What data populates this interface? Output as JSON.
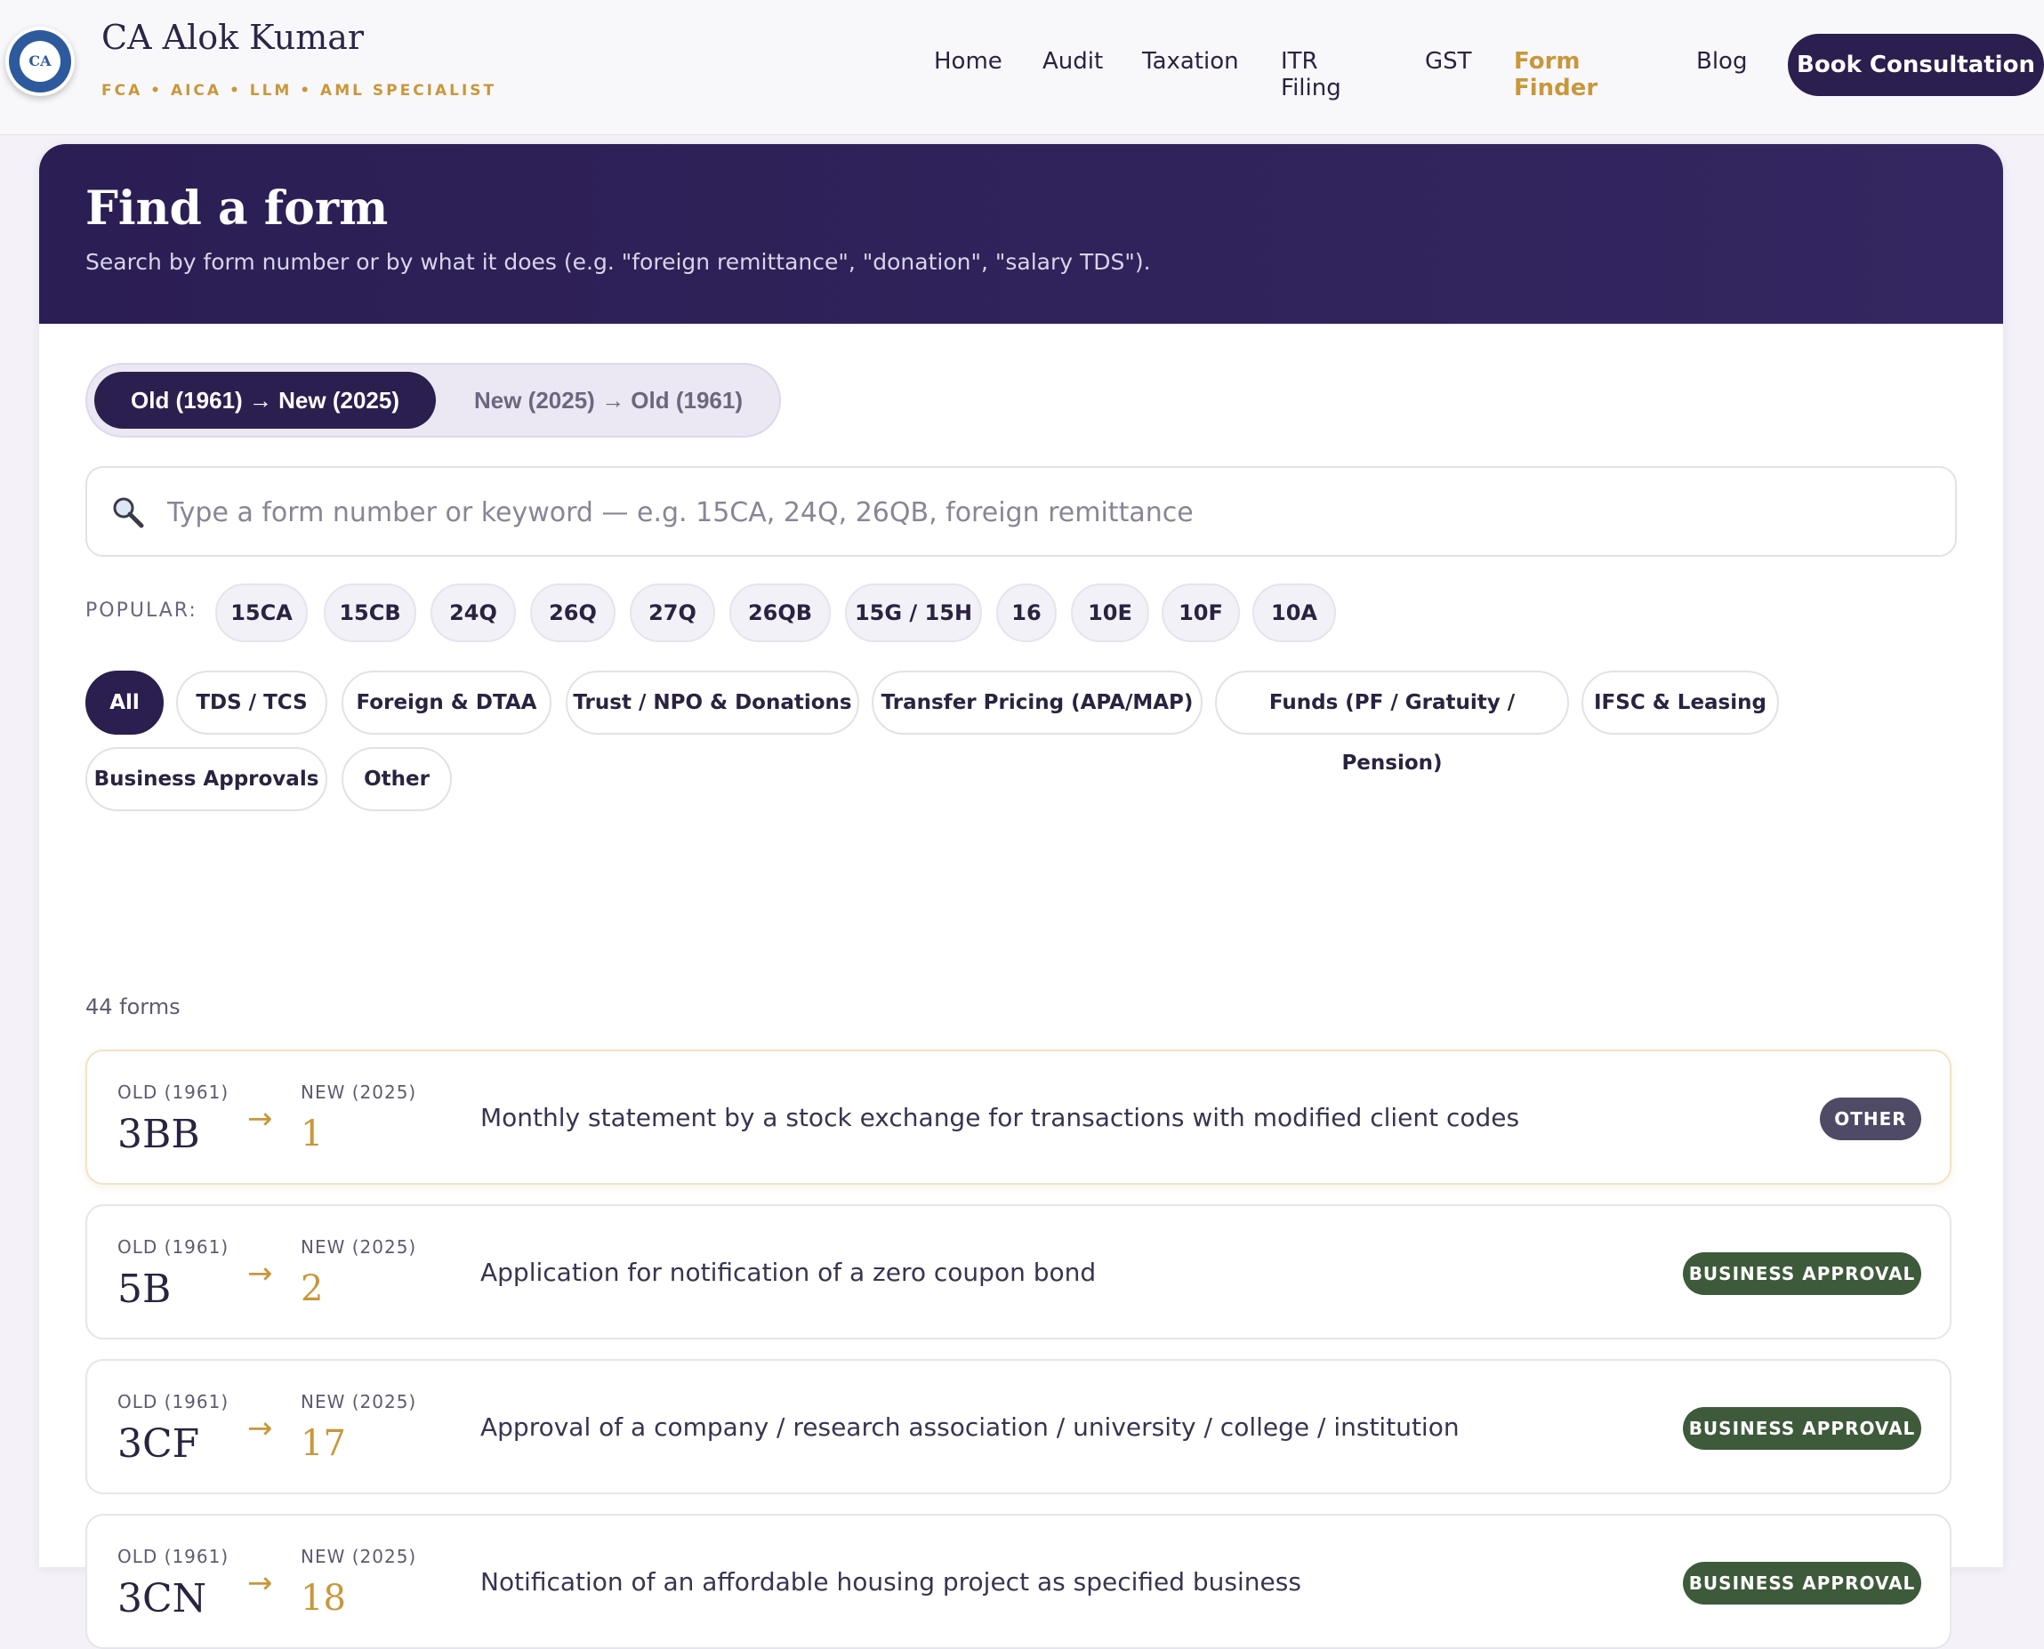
{
  "brand": {
    "name": "CA Alok Kumar",
    "tagline": "FCA • AICA • LLM • AML SPECIALIST",
    "logo_text": "CA"
  },
  "nav": {
    "items": [
      "Home",
      "Audit",
      "Taxation",
      "ITR Filing",
      "GST",
      "Form Finder",
      "Blog"
    ],
    "active": "Form Finder",
    "cta": "Book Consultation"
  },
  "hero": {
    "title": "Find a form",
    "subtitle": "Search by form number or by what it does (e.g. \"foreign remittance\", \"donation\", \"salary TDS\")."
  },
  "toggle": {
    "options": [
      "Old (1961) → New (2025)",
      "New (2025) → Old (1961)"
    ],
    "selected": "Old (1961) → New (2025)"
  },
  "search": {
    "placeholder": "Type a form number or keyword — e.g. 15CA, 24Q, 26QB, foreign remittance",
    "value": ""
  },
  "popular": {
    "label": "POPULAR:",
    "chips": [
      "15CA",
      "15CB",
      "24Q",
      "26Q",
      "27Q",
      "26QB",
      "15G / 15H",
      "16",
      "10E",
      "10F",
      "10A"
    ]
  },
  "filters": {
    "items": [
      "All",
      "TDS / TCS",
      "Foreign & DTAA",
      "Trust / NPO & Donations",
      "Transfer Pricing (APA/MAP)",
      "Funds (PF / Gratuity / Pension)",
      "IFSC & Leasing",
      "Business Approvals",
      "Other"
    ],
    "active": "All"
  },
  "results": {
    "count_text": "44 forms",
    "old_label": "OLD (1961)",
    "new_label": "NEW (2025)",
    "arrow": "→",
    "rows": [
      {
        "old": "3BB",
        "new": "1",
        "description": "Monthly statement by a stock exchange for transactions with modified client codes",
        "badge": "OTHER"
      },
      {
        "old": "5B",
        "new": "2",
        "description": "Application for notification of a zero coupon bond",
        "badge": "BUSINESS APPROVAL"
      },
      {
        "old": "3CF",
        "new": "17",
        "description": "Approval of a company / research association / university / college / institution",
        "badge": "BUSINESS APPROVAL"
      },
      {
        "old": "3CN",
        "new": "18",
        "description": "Notification of an affordable housing project as specified business",
        "badge": "BUSINESS APPROVAL"
      }
    ]
  },
  "colors": {
    "primary": "#2a1f4e",
    "accent": "#c9973a",
    "badge_other": "#4f4a66",
    "badge_business": "#3d5a3a"
  }
}
